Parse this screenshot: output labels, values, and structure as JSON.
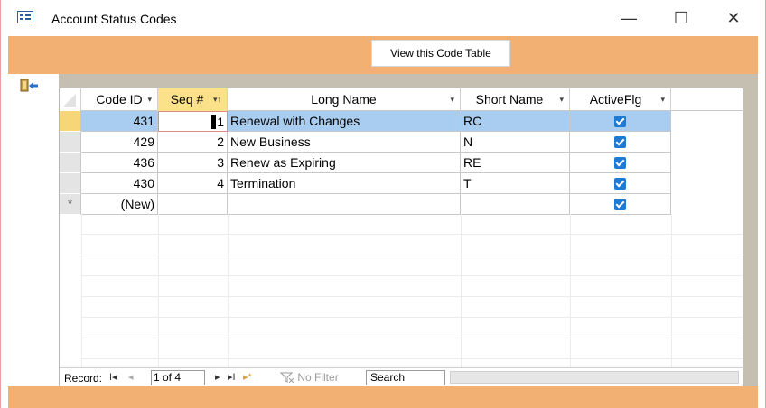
{
  "window": {
    "title": "Account Status Codes",
    "controls": {
      "minimize": "—",
      "maximize": "☐",
      "close": "✕"
    }
  },
  "header": {
    "view_button_label": "View this Code Table"
  },
  "columns": [
    {
      "label": "Code ID",
      "dropdown": "▾"
    },
    {
      "label": "Seq #",
      "dropdown": "▾↑",
      "sorted": true
    },
    {
      "label": "Long Name",
      "dropdown": "▾"
    },
    {
      "label": "Short Name",
      "dropdown": "▾"
    },
    {
      "label": "ActiveFlg",
      "dropdown": "▾"
    }
  ],
  "rows": [
    {
      "code_id": "431",
      "seq": "1",
      "long_name": "Renewal with Changes",
      "short_name": "RC",
      "active": true
    },
    {
      "code_id": "429",
      "seq": "2",
      "long_name": "New Business",
      "short_name": "N",
      "active": true
    },
    {
      "code_id": "436",
      "seq": "3",
      "long_name": "Renew as Expiring",
      "short_name": "RE",
      "active": true
    },
    {
      "code_id": "430",
      "seq": "4",
      "long_name": "Termination",
      "short_name": "T",
      "active": true
    }
  ],
  "new_row": {
    "marker": "*",
    "code_id": "(New)",
    "active": true
  },
  "navigation": {
    "record_label": "Record:",
    "first": "I◂",
    "prev": "◂",
    "position": "1 of 4",
    "next": "▸",
    "last": "▸I",
    "new": "▸*",
    "filter_label": "No Filter",
    "search_label": "Search"
  },
  "colors": {
    "band": "#f2b073",
    "detail_bg": "#c4bfb1",
    "selected_row": "#a9cdf0",
    "sorted_header": "#fbe28a",
    "check": "#1e7ad3"
  }
}
